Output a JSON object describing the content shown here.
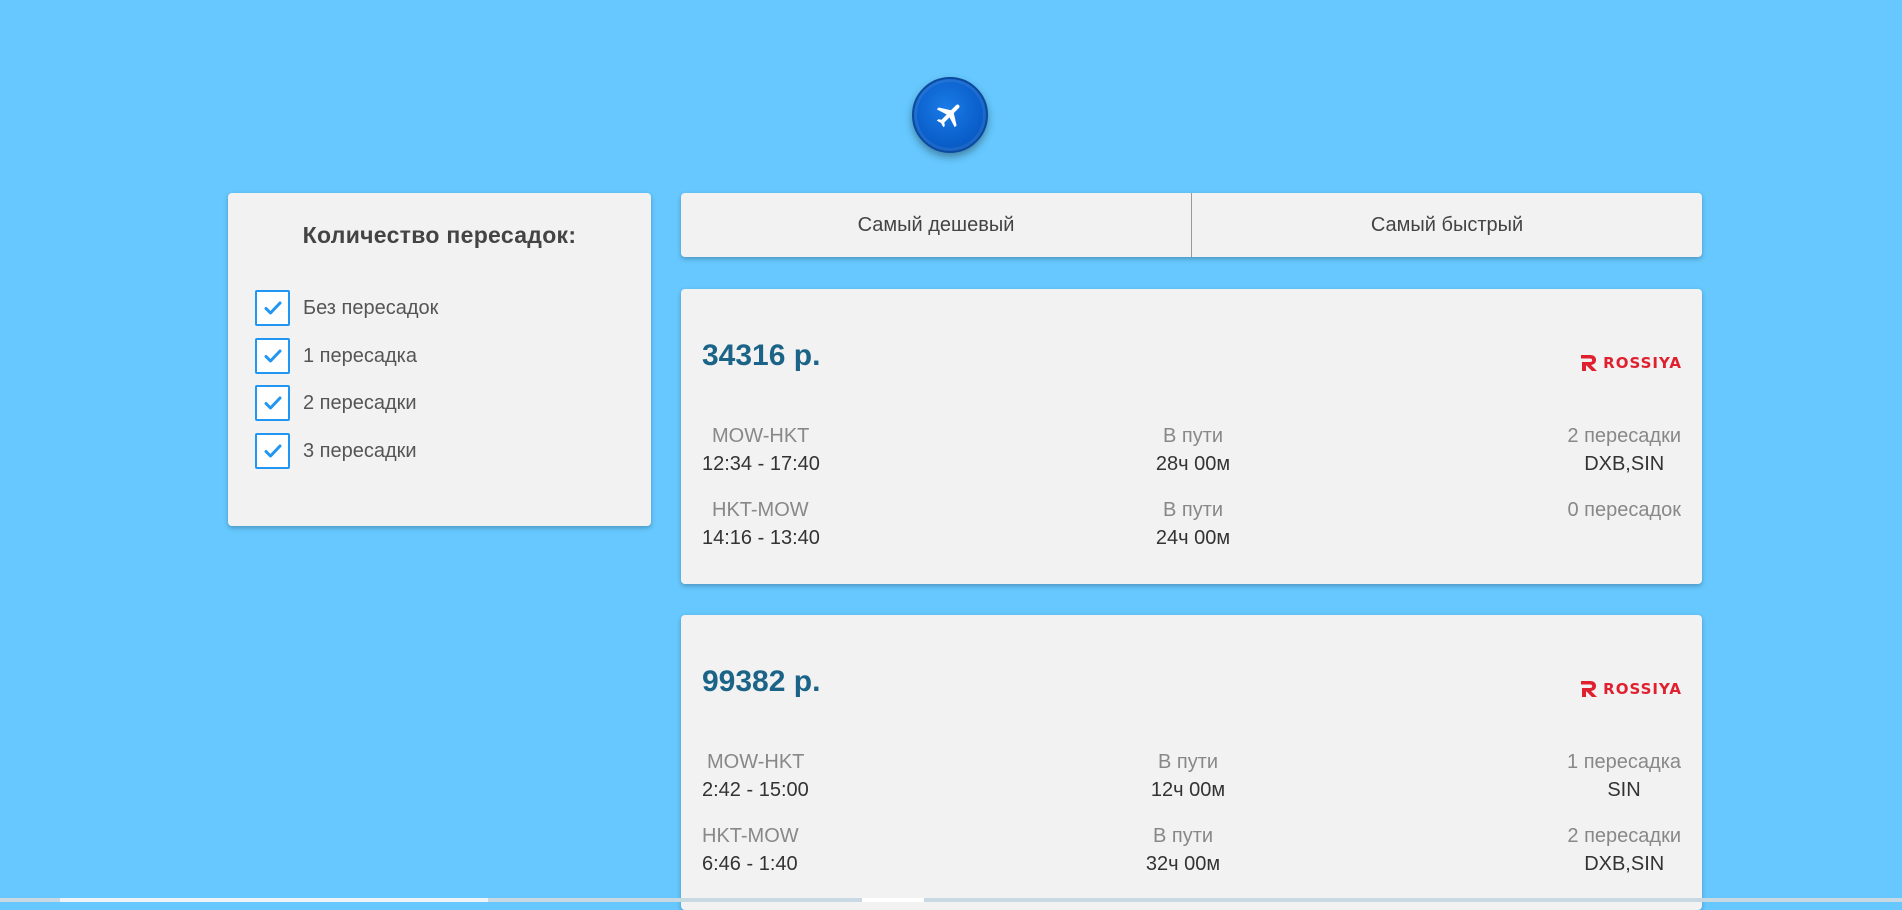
{
  "logo": {
    "icon": "airplane-icon"
  },
  "filter": {
    "title": "Количество пересадок:",
    "options": [
      {
        "label": "Без пересадок",
        "checked": true
      },
      {
        "label": "1 пересадка",
        "checked": true
      },
      {
        "label": "2 пересадки",
        "checked": true
      },
      {
        "label": "3 пересадки",
        "checked": true
      }
    ]
  },
  "sort": {
    "tabs": [
      {
        "label": "Самый дешевый"
      },
      {
        "label": "Самый быстрый"
      }
    ]
  },
  "tickets": [
    {
      "price": "34316 р.",
      "airline": "ROSSIYA",
      "segments": [
        {
          "route": "MOW-HKT",
          "time": "12:34 - 17:40",
          "duration_label": "В пути",
          "duration": "28ч 00м",
          "stops_label": "2 пересадки",
          "stops": "DXB,SIN"
        },
        {
          "route": "HKT-MOW",
          "time": "14:16 - 13:40",
          "duration_label": "В пути",
          "duration": "24ч 00м",
          "stops_label": "0 пересадок",
          "stops": ""
        }
      ]
    },
    {
      "price": "99382 р.",
      "airline": "ROSSIYA",
      "segments": [
        {
          "route": "MOW-HKT",
          "time": "2:42 - 15:00",
          "duration_label": "В пути",
          "duration": "12ч 00м",
          "stops_label": "1 пересадка",
          "stops": "SIN"
        },
        {
          "route": "HKT-MOW",
          "time": "6:46 - 1:40",
          "duration_label": "В пути",
          "duration": "32ч 00м",
          "stops_label": "2 пересадки",
          "stops": "DXB,SIN"
        }
      ]
    }
  ],
  "colors": {
    "background": "#66c8fe",
    "price": "#1b6488",
    "checkbox": "#2196f3",
    "airline": "#e0202e"
  }
}
